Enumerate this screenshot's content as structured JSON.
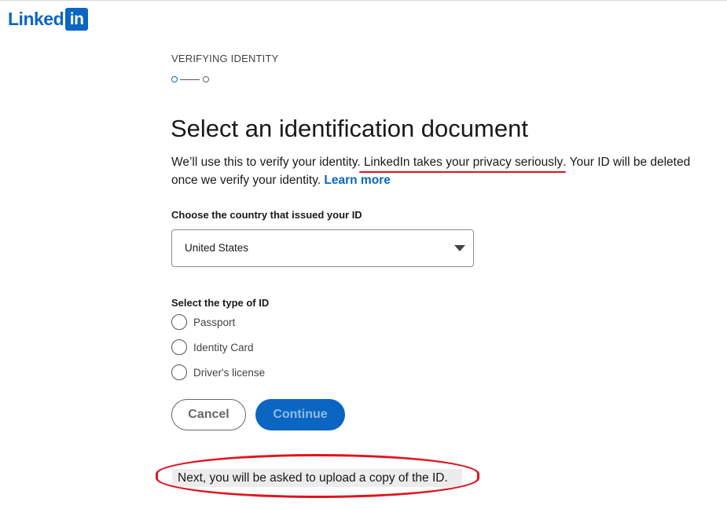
{
  "brand": {
    "logo_text": "Linked",
    "logo_box_text": "in",
    "color": "#0a66c2"
  },
  "header": {
    "eyebrow": "VERIFYING IDENTITY",
    "progress": {
      "current_step": 1,
      "total_steps": 2
    }
  },
  "main": {
    "title": "Select an identification document",
    "description_before": "We’ll use this to verify your identity. ",
    "description_privacy": "LinkedIn takes your privacy seriously",
    "description_after": ". Your ID will be deleted once we verify your identity. ",
    "learn_more": "Learn more"
  },
  "country": {
    "label": "Choose the country that issued your ID",
    "selected": "United States"
  },
  "id_type": {
    "label": "Select the type of ID",
    "options": [
      "Passport",
      "Identity Card",
      "Driver's license"
    ]
  },
  "buttons": {
    "cancel": "Cancel",
    "continue": "Continue"
  },
  "note": "Next, you will be asked to upload a copy of the ID.",
  "colors": {
    "accent": "#0a66c2",
    "annotation": "#e0141e"
  }
}
